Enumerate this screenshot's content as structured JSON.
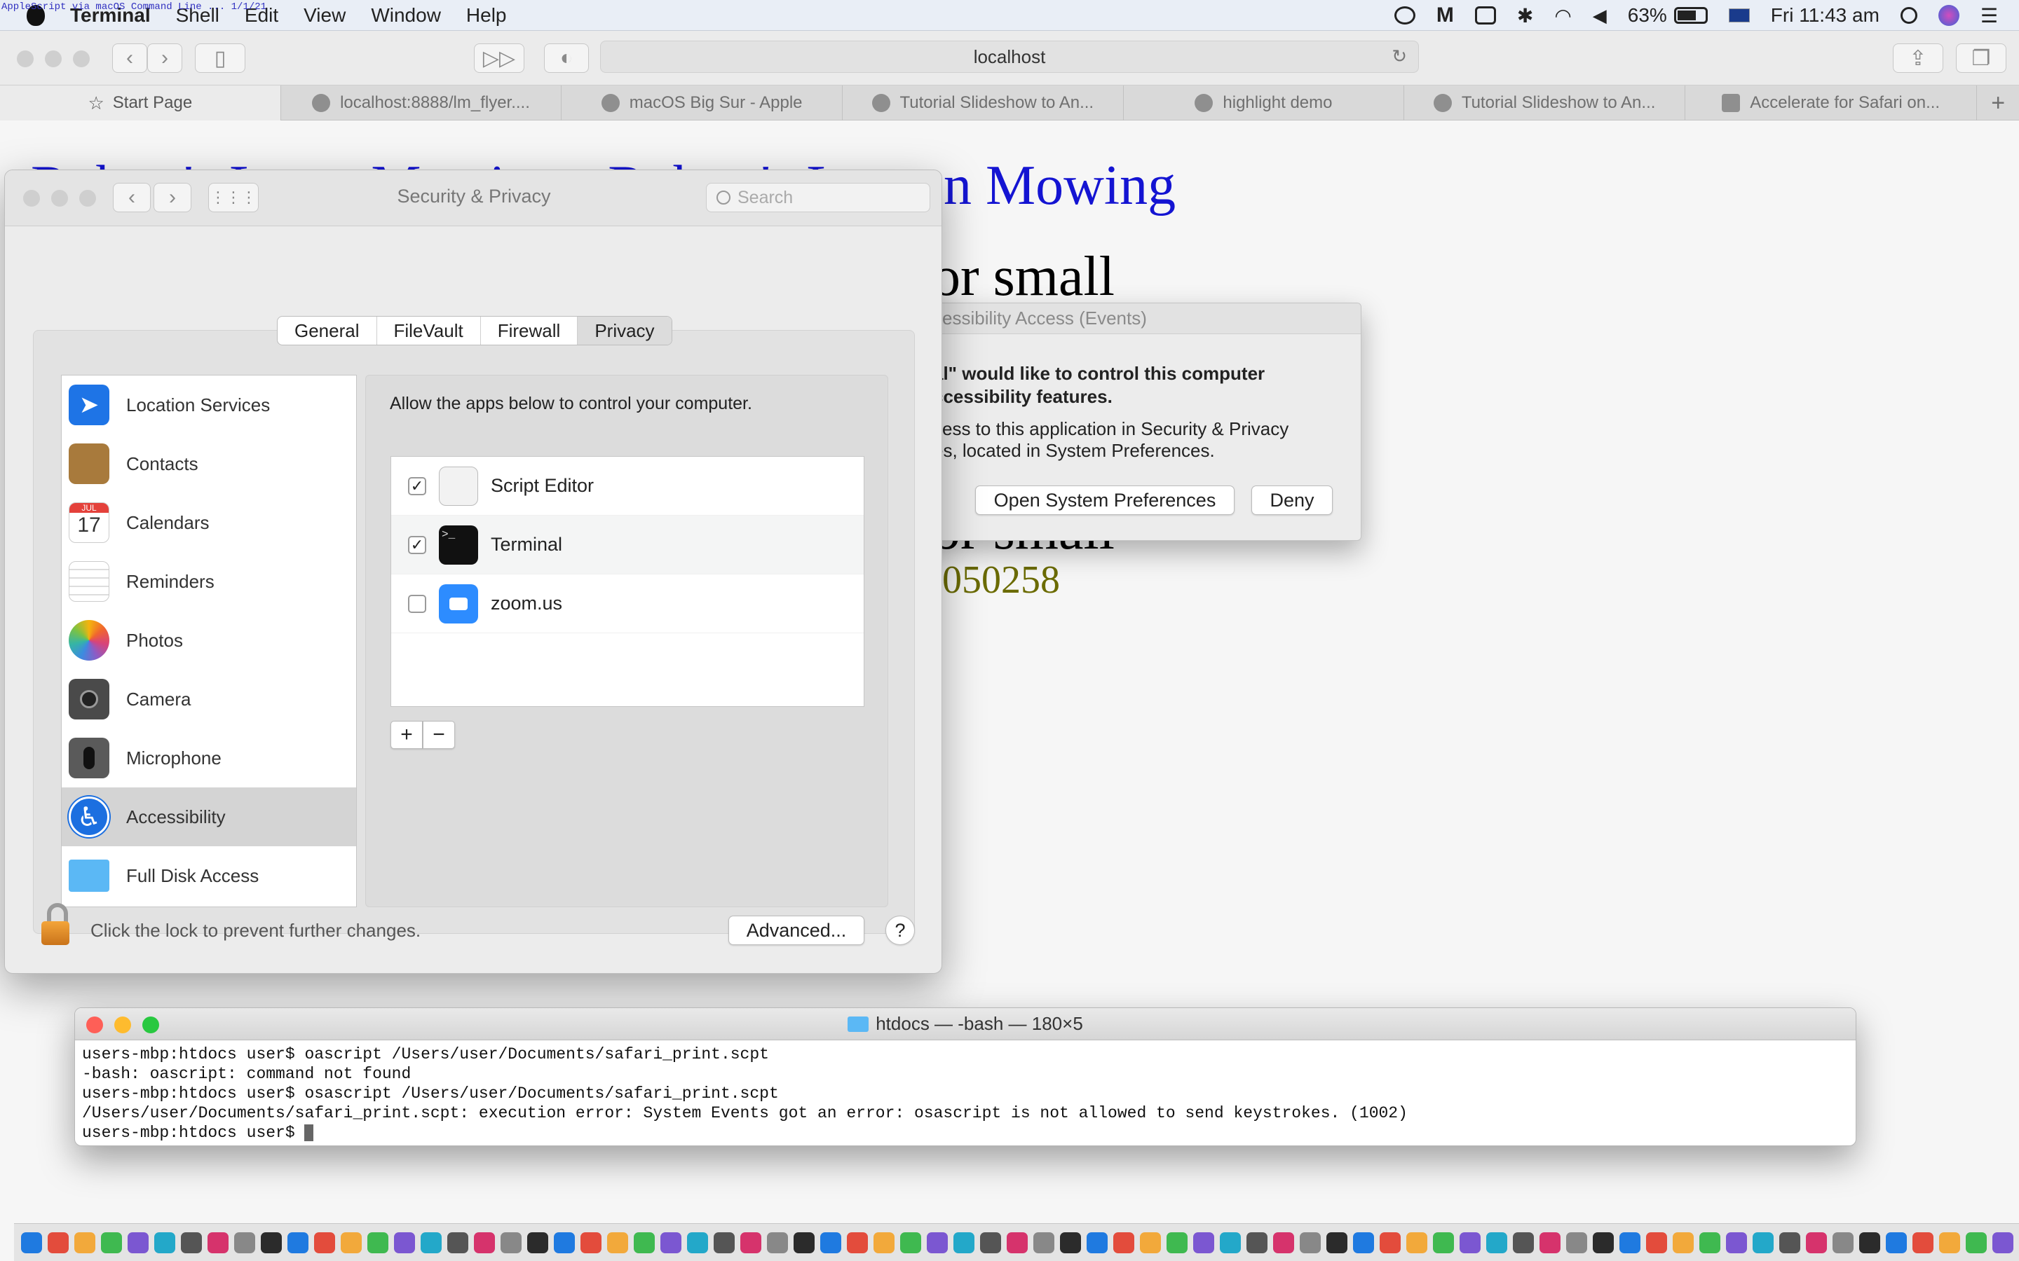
{
  "menubar": {
    "app": "Terminal",
    "items": [
      "Shell",
      "Edit",
      "View",
      "Window",
      "Help"
    ],
    "battery": "63%",
    "clock": "Fri 11:43 am",
    "overlay_text": "AppleScript via macOS Command Line ... 1/1/21"
  },
  "safari": {
    "address": "localhost",
    "tabs": [
      {
        "label": "Start Page",
        "icon": "star-icon"
      },
      {
        "label": "localhost:8888/lm_flyer....",
        "icon": "globe-icon"
      },
      {
        "label": "macOS Big Sur - Apple",
        "icon": "apple-icon"
      },
      {
        "label": "Tutorial Slideshow to An...",
        "icon": "globe-icon"
      },
      {
        "label": "highlight demo",
        "icon": "globe-icon"
      },
      {
        "label": "Tutorial Slideshow to An...",
        "icon": "globe-icon"
      },
      {
        "label": "Accelerate for Safari on...",
        "icon": "app-store-icon"
      }
    ],
    "new_tab": "+"
  },
  "web": {
    "heading_left": "Robert's Lawn Mowing - Robert's Lawn",
    "heading_right": "n Mowing",
    "line2": "or small",
    "line3": "or small",
    "line4": ".050258"
  },
  "prefs": {
    "title": "Security & Privacy",
    "search_placeholder": "Search",
    "tabs": [
      "General",
      "FileVault",
      "Firewall",
      "Privacy"
    ],
    "selected_tab": "Privacy",
    "sidebar": [
      {
        "label": "Location Services",
        "icon": "location-arrow-icon",
        "color": "#1e74e6"
      },
      {
        "label": "Contacts",
        "icon": "contacts-book-icon",
        "color": "#a87a3c"
      },
      {
        "label": "Calendars",
        "icon": "calendar-icon",
        "color": "#ffffff",
        "day": "17",
        "month": "JUL"
      },
      {
        "label": "Reminders",
        "icon": "reminders-list-icon",
        "color": "#ffffff"
      },
      {
        "label": "Photos",
        "icon": "photos-flower-icon",
        "color": "#f0a030"
      },
      {
        "label": "Camera",
        "icon": "camera-icon",
        "color": "#4a4a4a"
      },
      {
        "label": "Microphone",
        "icon": "microphone-icon",
        "color": "#5a5a5a"
      },
      {
        "label": "Accessibility",
        "icon": "accessibility-icon",
        "color": "#1c6fe0"
      },
      {
        "label": "Full Disk Access",
        "icon": "folder-icon",
        "color": "#5bb8f5"
      }
    ],
    "selected_sidebar": "Accessibility",
    "detail_text": "Allow the apps below to control your computer.",
    "apps": [
      {
        "name": "Script Editor",
        "checked": true,
        "icon": "script-editor-icon"
      },
      {
        "name": "Terminal",
        "checked": true,
        "icon": "terminal-icon"
      },
      {
        "name": "zoom.us",
        "checked": false,
        "icon": "zoom-camera-icon"
      }
    ],
    "add_label": "+",
    "remove_label": "−",
    "lock_text": "Click the lock to prevent further changes.",
    "advanced_label": "Advanced...",
    "help_label": "?"
  },
  "alert": {
    "title": "cessibility Access (Events)",
    "bold_line1": "al\" would like to control this computer",
    "bold_line2": "ccessibility features.",
    "line1": "cess to this application in Security & Privacy",
    "line2": "es, located in System Preferences.",
    "open_label": "Open System Preferences",
    "deny_label": "Deny"
  },
  "terminal": {
    "title": "htdocs — -bash — 180×5",
    "lines": [
      "users-mbp:htdocs user$ oascript /Users/user/Documents/safari_print.scpt",
      "-bash: oascript: command not found",
      "users-mbp:htdocs user$ osascript /Users/user/Documents/safari_print.scpt",
      "/Users/user/Documents/safari_print.scpt: execution error: System Events got an error: osascript is not allowed to send keystrokes. (1002)",
      "users-mbp:htdocs user$ "
    ]
  },
  "colors": {
    "link_blue": "#1414d2",
    "olive": "#6b6b00",
    "close_red": "#fe5f57",
    "minimize_yellow": "#febb2e",
    "zoom_green": "#28c840"
  }
}
